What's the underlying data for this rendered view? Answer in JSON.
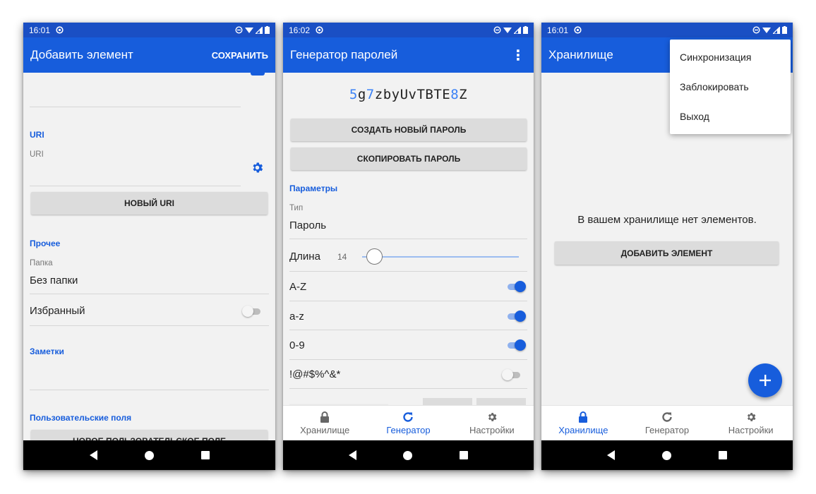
{
  "status": {
    "phone1_time": "16:01",
    "phone2_time": "16:02",
    "phone3_time": "16:01"
  },
  "screen1": {
    "title": "Добавить элемент",
    "save_label": "СОХРАНИТЬ",
    "uri_section": "URI",
    "uri_field_label": "URI",
    "new_uri_button": "НОВЫЙ URI",
    "other_section": "Прочее",
    "folder_label": "Папка",
    "folder_value": "Без папки",
    "favorite_label": "Избранный",
    "favorite_on": false,
    "notes_section": "Заметки",
    "custom_fields_section": "Пользовательские поля",
    "new_custom_field_button": "НОВОЕ ПОЛЬЗОВАТЕЛЬСКОЕ ПОЛЕ"
  },
  "screen2": {
    "title": "Генератор паролей",
    "password_parts": [
      {
        "t": "5",
        "c": "digit"
      },
      {
        "t": "g",
        "c": "letter"
      },
      {
        "t": "7",
        "c": "digit"
      },
      {
        "t": "zbyUvTBTE",
        "c": "letter"
      },
      {
        "t": "8",
        "c": "digit"
      },
      {
        "t": "Z",
        "c": "letter"
      }
    ],
    "create_button": "СОЗДАТЬ НОВЫЙ ПАРОЛЬ",
    "copy_button": "СКОПИРОВАТЬ ПАРОЛЬ",
    "params_section": "Параметры",
    "type_label": "Тип",
    "type_value": "Пароль",
    "length_label": "Длина",
    "length_value": "14",
    "options": [
      {
        "label": "A-Z",
        "on": true
      },
      {
        "label": "a-z",
        "on": true
      },
      {
        "label": "0-9",
        "on": true
      },
      {
        "label": "!@#$%^&*",
        "on": false
      }
    ]
  },
  "screen3": {
    "title": "Хранилище",
    "menu_items": [
      "Синхронизация",
      "Заблокировать",
      "Выход"
    ],
    "empty_text": "В вашем хранилище нет элементов.",
    "add_button": "ДОБАВИТЬ ЭЛЕМЕНТ",
    "fab_icon": "plus-icon"
  },
  "tabs": {
    "vault": "Хранилище",
    "generator": "Генератор",
    "settings": "Настройки"
  },
  "colors": {
    "accent": "#175ddc",
    "statusbar": "#1a4fc4",
    "password_digit": "#3b82f6",
    "password_letter": "#222222"
  }
}
